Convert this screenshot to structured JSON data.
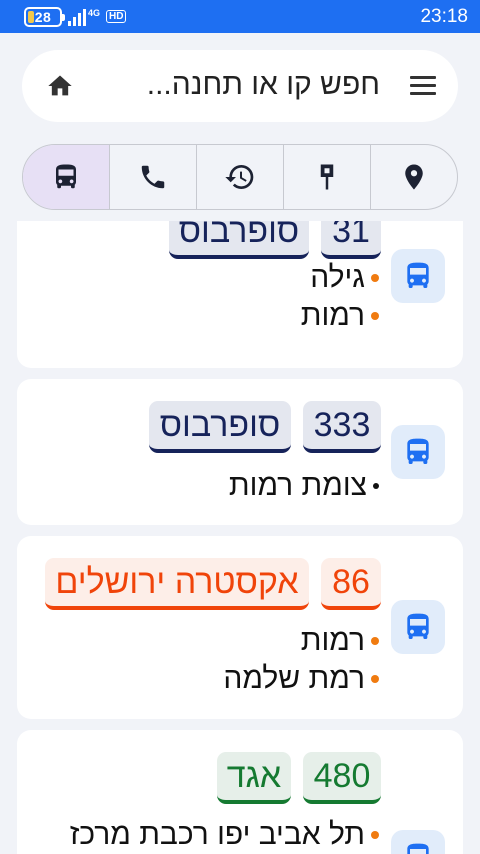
{
  "status_bar": {
    "battery": "28",
    "network": "4G",
    "hd": "HD",
    "time": "23:18"
  },
  "search": {
    "placeholder": "חפש קו או תחנה..."
  },
  "colors": {
    "primary": "#1e6ff2",
    "navy": "#16235a",
    "red": "#f0440a",
    "green": "#157a31",
    "bullet_orange": "#f07b10"
  },
  "tabs": [
    {
      "icon": "bus-icon",
      "active": true
    },
    {
      "icon": "phone-icon"
    },
    {
      "icon": "history-icon"
    },
    {
      "icon": "bus-stop-sign-icon"
    },
    {
      "icon": "location-pin-icon"
    }
  ],
  "routes": [
    {
      "number": "31",
      "operator": "סופרבוס",
      "style": "navy",
      "stops": [
        "גילה",
        "רמות"
      ]
    },
    {
      "number": "333",
      "operator": "סופרבוס",
      "style": "navy",
      "stops": [
        "צומת רמות"
      ]
    },
    {
      "number": "86",
      "operator": "אקסטרה ירושלים",
      "style": "red",
      "stops": [
        "רמות",
        "רמת שלמה"
      ]
    },
    {
      "number": "480",
      "operator": "אגד",
      "style": "green",
      "stops": [
        "תל אביב יפו רכבת מרכז"
      ]
    }
  ]
}
